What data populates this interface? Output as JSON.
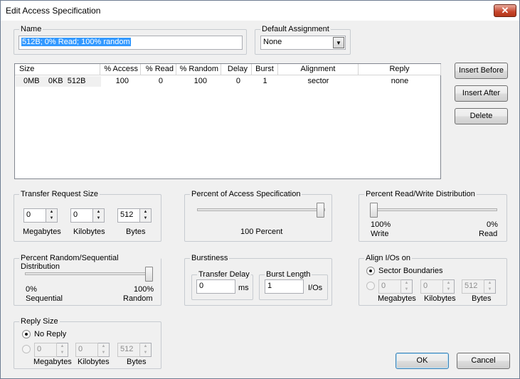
{
  "window": {
    "title": "Edit Access Specification",
    "close_label": "✕"
  },
  "name_group": {
    "label": "Name",
    "value": "512B; 0% Read; 100% random"
  },
  "default_assignment": {
    "label": "Default Assignment",
    "value": "None"
  },
  "table": {
    "headers": [
      "Size",
      "% Access",
      "% Read",
      "% Random",
      "Delay",
      "Burst",
      "Alignment",
      "Reply"
    ],
    "rows": [
      {
        "size": "0MB    0KB  512B",
        "access": "100",
        "read": "0",
        "random": "100",
        "delay": "0",
        "burst": "1",
        "alignment": "sector",
        "reply": "none"
      }
    ]
  },
  "buttons": {
    "insert_before": "Insert Before",
    "insert_after": "Insert After",
    "delete": "Delete",
    "ok": "OK",
    "cancel": "Cancel"
  },
  "transfer": {
    "label": "Transfer Request Size",
    "megabytes": "0",
    "kilobytes": "0",
    "bytes": "512",
    "mb_label": "Megabytes",
    "kb_label": "Kilobytes",
    "b_label": "Bytes"
  },
  "percent_access": {
    "label": "Percent of Access Specification",
    "value_label": "100 Percent",
    "value": 100
  },
  "read_write": {
    "label": "Percent Read/Write Distribution",
    "left_pct": "100%",
    "left_label": "Write",
    "right_pct": "0%",
    "right_label": "Read",
    "read_percent": 0
  },
  "random_seq": {
    "label": "Percent Random/Sequential Distribution",
    "left_pct": "0%",
    "left_label": "Sequential",
    "right_pct": "100%",
    "right_label": "Random",
    "random_percent": 100
  },
  "burstiness": {
    "label": "Burstiness",
    "delay_label": "Transfer Delay",
    "delay_value": "0",
    "delay_unit": "ms",
    "burst_label": "Burst Length",
    "burst_value": "1",
    "burst_unit": "I/Os"
  },
  "align": {
    "label": "Align I/Os on",
    "sector_label": "Sector Boundaries",
    "megabytes": "0",
    "kilobytes": "0",
    "bytes": "512",
    "mb_label": "Megabytes",
    "kb_label": "Kilobytes",
    "b_label": "Bytes"
  },
  "reply": {
    "label": "Reply Size",
    "no_reply_label": "No Reply",
    "megabytes": "0",
    "kilobytes": "0",
    "bytes": "512",
    "mb_label": "Megabytes",
    "kb_label": "Kilobytes",
    "b_label": "Bytes"
  }
}
